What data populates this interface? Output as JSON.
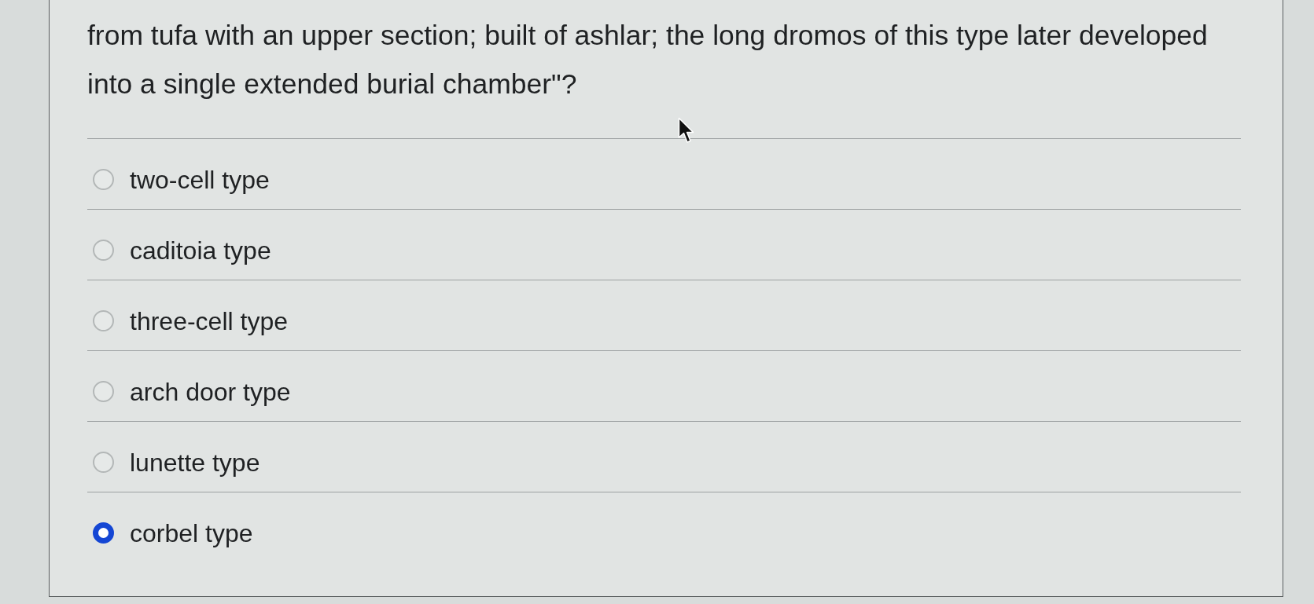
{
  "question": {
    "text": "from tufa with an upper section; built of ashlar; the long dromos of this type later developed into a single extended burial chamber\"?"
  },
  "options": [
    {
      "label": "two-cell type",
      "selected": false
    },
    {
      "label": "caditoia type",
      "selected": false
    },
    {
      "label": "three-cell type",
      "selected": false
    },
    {
      "label": "arch door type",
      "selected": false
    },
    {
      "label": "lunette type",
      "selected": false
    },
    {
      "label": "corbel type",
      "selected": true
    }
  ]
}
